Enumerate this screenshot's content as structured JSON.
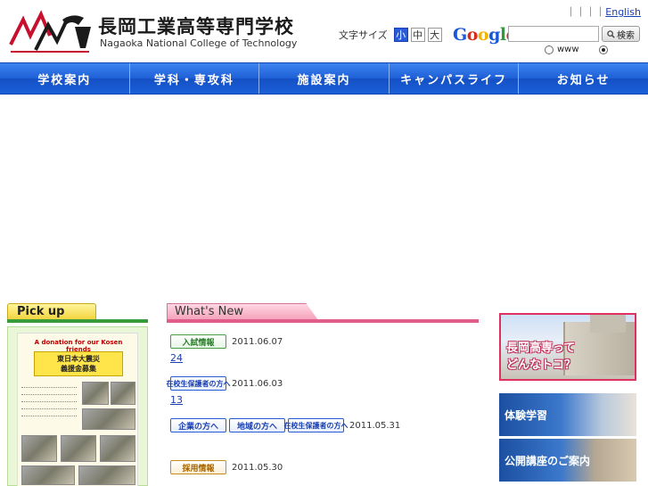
{
  "header": {
    "college_name_jp": "長岡工業高等専門学校",
    "college_name_en": "Nagaoka National College of Technology",
    "top_links": [
      "",
      "",
      "",
      ""
    ],
    "english_link": "English",
    "font_size_label": "文字サイズ",
    "font_sizes": [
      "小",
      "中",
      "大"
    ],
    "font_size_selected": "小",
    "google_logo": "Google",
    "search_placeholder": "",
    "search_button": "検索",
    "search_scopes": [
      "www",
      ""
    ],
    "search_scope_selected": 1
  },
  "nav": {
    "items": [
      "学校案内",
      "学科・専攻科",
      "施設案内",
      "キャンパスライフ",
      "お知らせ"
    ]
  },
  "pickup": {
    "heading": "Pick up",
    "card_title": "A donation for our Kosen friends",
    "card_banner_line1": "東日本大震災",
    "card_banner_line2": "義援金募集"
  },
  "whats_new": {
    "heading": "What's New",
    "items": [
      {
        "badges": [
          "入試情報"
        ],
        "badge_types": [
          "nyushi"
        ],
        "date": "2011.06.07",
        "link": "24 "
      },
      {
        "badges": [
          "在校生保護者の方へ"
        ],
        "badge_types": [
          "hogosha"
        ],
        "date": "2011.06.03",
        "link": "13"
      },
      {
        "badges": [
          "企業の方へ",
          "地域の方へ",
          "在校生保護者の方へ"
        ],
        "badge_types": [
          "kigyo",
          "chiiki",
          "hogosha"
        ],
        "date": "2011.05.31",
        "link": ""
      },
      {
        "badges": [
          "採用情報"
        ],
        "badge_types": [
          "saiyo"
        ],
        "date": "2011.05.30",
        "link": ""
      }
    ]
  },
  "banners": {
    "donnatoko_line1": "長岡高専って",
    "donnatoko_line2": "どんなトコ？",
    "taiken": "体験学習",
    "koukai": "公開講座のご案内"
  },
  "colors": {
    "nav_blue": "#1e5fd6",
    "pickup_green": "#3a9b3a",
    "whatsnew_pink": "#e05c8b",
    "link_blue": "#1a3fb3"
  }
}
